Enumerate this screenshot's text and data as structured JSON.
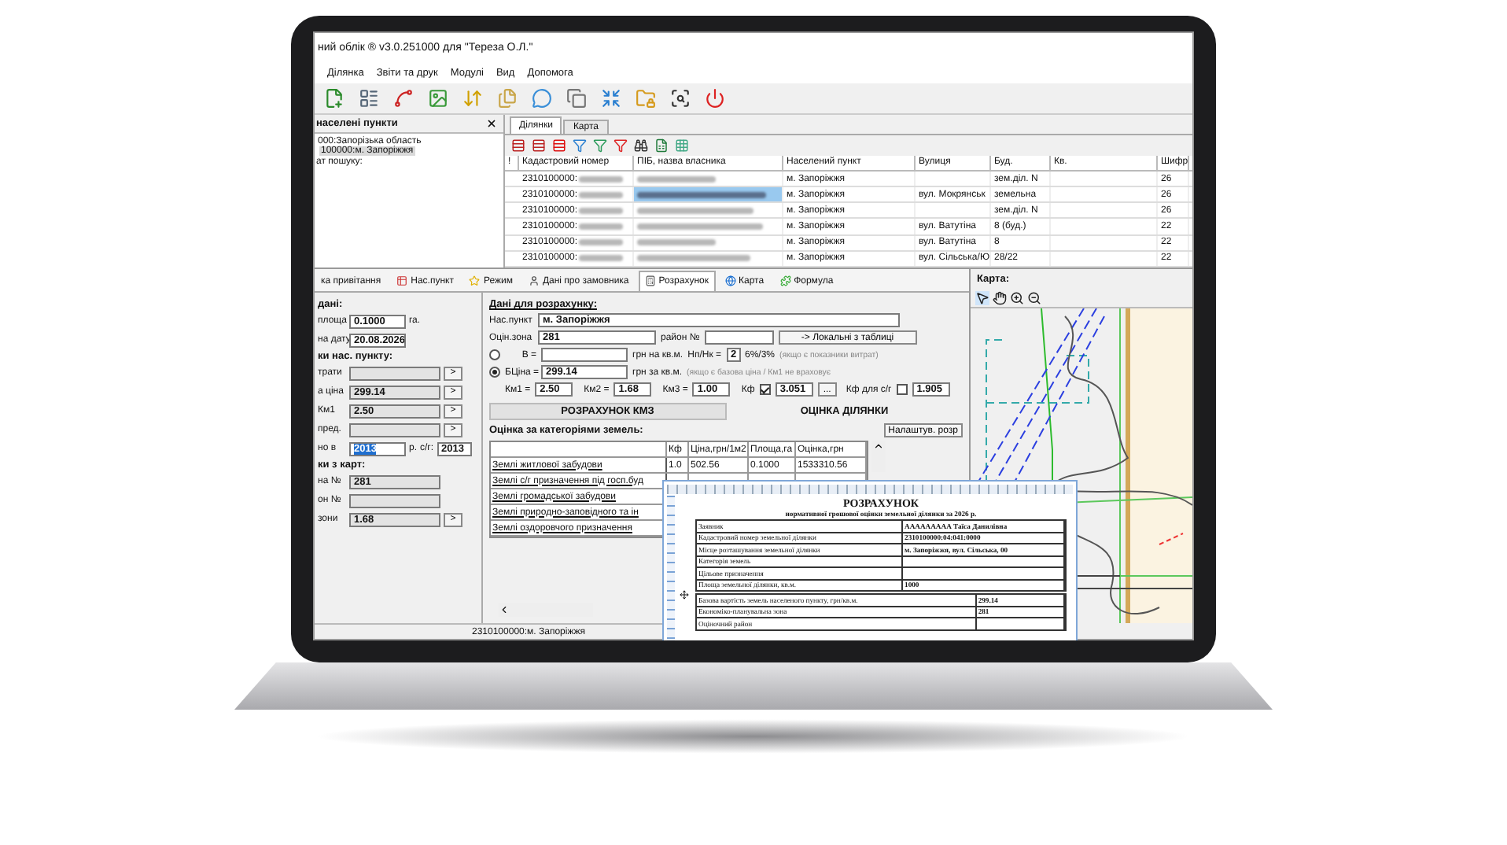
{
  "window": {
    "title": "ний облік ® v3.0.251000 для \"Тереза О.Л.\""
  },
  "menu": [
    "Ділянка",
    "Звіти та друк",
    "Модулі",
    "Вид",
    "Допомога"
  ],
  "settlements": {
    "title": "населені пункти",
    "tree": [
      {
        "label": "000:Запорізька область",
        "selected": false,
        "children": [
          {
            "label": "100000:м. Запоріжжя",
            "selected": true
          }
        ]
      }
    ],
    "search_label": "ат пошуку:"
  },
  "top_tabs": [
    {
      "label": "Ділянки",
      "selected": true
    },
    {
      "label": "Карта",
      "selected": false
    }
  ],
  "parcels": {
    "columns": [
      "!",
      "Кадастровий номер",
      "ПІБ, назва власника",
      "Населений пункт",
      "Вулиця",
      "Буд.",
      "Кв.",
      "Шифр"
    ],
    "rows": [
      {
        "cadastral": "2310100000:",
        "settlement": "м. Запоріжжя",
        "building": "зем.діл. N",
        "code": "26",
        "selected": false
      },
      {
        "cadastral": "2310100000:",
        "settlement": "м. Запоріжжя",
        "street": "вул. Мокрянськ",
        "building": "земельна",
        "code": "26",
        "selected": true
      },
      {
        "cadastral": "2310100000:",
        "settlement": "м. Запоріжжя",
        "building": "зем.діл. N",
        "code": "26",
        "selected": false
      },
      {
        "cadastral": "2310100000:",
        "settlement": "м. Запоріжжя",
        "street": "вул. Ватутіна",
        "building": "8 (буд.)",
        "code": "22",
        "selected": false
      },
      {
        "cadastral": "2310100000:",
        "settlement": "м. Запоріжжя",
        "street": "вул. Ватутіна",
        "building": "8",
        "code": "22",
        "selected": false
      },
      {
        "cadastral": "2310100000:",
        "settlement": "м. Запоріжжя",
        "street": "вул. Сільська/Ю",
        "building": "28/22",
        "code": "22",
        "selected": false
      }
    ]
  },
  "form_tabs": [
    {
      "label": "ка привітання",
      "selected": false
    },
    {
      "label": "Нас.пункт",
      "selected": false
    },
    {
      "label": "Режим",
      "selected": false
    },
    {
      "label": "Дані про замовника",
      "selected": false
    },
    {
      "label": "Розрахунок",
      "selected": true
    },
    {
      "label": "Карта",
      "selected": false
    },
    {
      "label": "Формула",
      "selected": false
    }
  ],
  "left_groups": [
    {
      "title": "дані:",
      "rows": [
        {
          "label": "площа",
          "value": "0.1000",
          "unit": "га."
        },
        {
          "label": "на дату",
          "value": "20.08.2026"
        }
      ]
    },
    {
      "title": "ки нас. пункту:",
      "rows": [
        {
          "label": "трати",
          "button": ">"
        },
        {
          "label": "а ціна",
          "value": "299.14",
          "button": ">"
        },
        {
          "label": "Км1",
          "value": "2.50",
          "button": ">"
        },
        {
          "label": "пред.",
          "button": ">"
        },
        {
          "label": "но в",
          "value": "2013",
          "highlighted": true,
          "unit": "р.",
          "extra_label": "с/г:",
          "extra_value": "2013"
        }
      ]
    },
    {
      "title": "ки з карт:",
      "rows": [
        {
          "label": "на №",
          "value": "281"
        },
        {
          "label": "он №"
        },
        {
          "label": "зони",
          "value": "1.68",
          "button": ">"
        }
      ]
    }
  ],
  "calc": {
    "title": "Дані для розрахунку:",
    "settlement_label": "Нас.пункт",
    "settlement": "м. Запоріжжя",
    "zone_label": "Оцін.зона",
    "zone": "281",
    "district_label": "район №",
    "local_button": "-> Локальні з таблиці",
    "radios": [
      {
        "label": "В =",
        "unit": "грн на кв.м.",
        "checked": false,
        "ratio_label": "Нп/Нк =",
        "ratio": "2",
        "ratio_unit": "6%/3%",
        "note": "(якщо є показники витрат)"
      },
      {
        "label": "БЦіна =",
        "value": "299.14",
        "unit": "грн за кв.м.",
        "checked": true,
        "note": "(якщо є базова ціна / Км1 не враховує"
      }
    ],
    "coefs": [
      {
        "label": "Км1 =",
        "value": "2.50"
      },
      {
        "label": "Км2 =",
        "value": "1.68"
      },
      {
        "label": "Км3 =",
        "value": "1.00"
      }
    ],
    "kf": {
      "label": "Кф",
      "checked": true,
      "value": "3.051",
      "button": "..."
    },
    "kf_ag": {
      "label": "Кф для с/г",
      "checked": false,
      "value": "1.905"
    },
    "tabs": [
      {
        "label": "РОЗРАХУНОК КМЗ",
        "selected": false
      },
      {
        "label": "ОЦІНКА ДІЛЯНКИ",
        "selected": true
      }
    ],
    "categories_title": "Оцінка за категоріями земель:",
    "settings_button": "Налаштув. розр",
    "grid": {
      "columns": [
        "Кф",
        "Ціна,грн/1м2",
        "Площа,га",
        "Оцінка,грн"
      ],
      "rows": [
        {
          "name": "Землі житлової забудови",
          "values": [
            "1.0",
            "502.56",
            "0.1000",
            "1533310.56"
          ]
        },
        {
          "name": "Землі с/г призначення під госп.буд",
          "values": []
        },
        {
          "name": "Землі громадської забудови",
          "values": []
        },
        {
          "name": "Землі природно-заповідного та ін",
          "values": []
        },
        {
          "name": "Землі оздоровчого призначення",
          "values": []
        }
      ]
    }
  },
  "status_bar": "2310100000:м. Запоріжжя",
  "map": {
    "title": "Карта:"
  },
  "report": {
    "title": "РОЗРАХУНОК",
    "subtitle": "нормативної грошової оцінки земельної ділянки за 2026 р.",
    "rows_a": [
      {
        "label": "Заявник",
        "value": "ААААААААА Таїса Данилівна"
      },
      {
        "label": "Кадастровий номер земельної ділянки",
        "value": "2310100000:04:041:0000"
      },
      {
        "label": "Місце розташування земельної ділянки",
        "value": "м. Запоріжжя, вул. Сільська, 00"
      },
      {
        "label": "Категорія земель"
      },
      {
        "label": "Цільове призначення"
      },
      {
        "label": "Площа земельної ділянки, кв.м.",
        "value": "1000"
      }
    ],
    "rows_b": [
      {
        "label": "Базова вартість земель населеного пункту, грн/кв.м.",
        "value": "299.14"
      },
      {
        "label": "Економіко-планувальна зона",
        "value": "281"
      },
      {
        "label": "Оціночний район"
      }
    ]
  }
}
